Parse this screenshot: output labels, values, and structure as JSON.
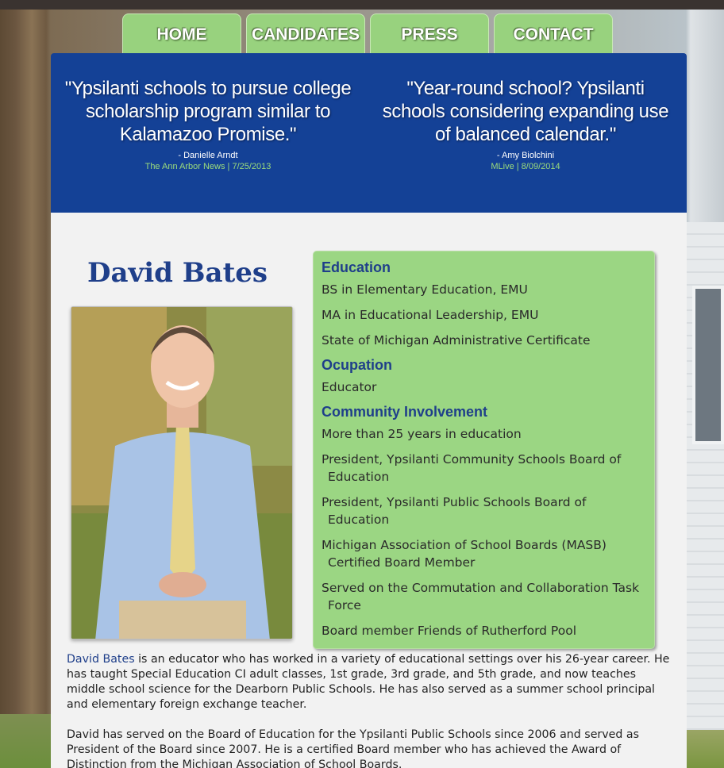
{
  "nav": {
    "items": [
      {
        "label": "HOME"
      },
      {
        "label": "CANDIDATES"
      },
      {
        "label": "PRESS"
      },
      {
        "label": "CONTACT"
      }
    ]
  },
  "quotes": [
    {
      "text": "\"Ypsilanti schools to pursue college scholarship program similar to Kalamazoo Promise.\"",
      "author": "- Danielle Arndt",
      "source": "The Ann Arbor News | 7/25/2013"
    },
    {
      "text": "\"Year-round school? Ypsilanti schools considering expanding use of balanced calendar.\"",
      "author": "- Amy Biolchini",
      "source": "MLive | 8/09/2014"
    }
  ],
  "candidate": {
    "name": "David Bates"
  },
  "info": {
    "education_title": "Education",
    "education": [
      "BS in Elementary Education, EMU",
      "MA in Educational Leadership, EMU",
      "State of Michigan Administrative Certificate"
    ],
    "occupation_title": "Ocupation",
    "occupation": [
      "Educator"
    ],
    "community_title": "Community Involvement",
    "community": [
      "More than 25 years in education",
      "President, Ypsilanti Community Schools Board of Education",
      "President, Ypsilanti Public Schools Board of Education",
      "Michigan Association of School Boards (MASB) Certified Board Member",
      "Served on the Commutation and Collaboration Task Force",
      "Board member Friends of Rutherford Pool"
    ]
  },
  "bio": {
    "name": "David Bates",
    "p1_rest": " is an educator who has worked in a variety of educational settings over his 26-year career. He has taught Special Education CI adult classes, 1st grade, 3rd grade, and 5th grade, and now teaches middle school science for the Dearborn Public Schools. He has also served as a summer school principal and elementary foreign exchange teacher.",
    "p2": "David has served on the Board of Education for the Ypsilanti Public Schools since 2006 and served as President of the Board since 2007. He is a certified Board member who has achieved the Award of Distinction from the Michigan Association of School Boards."
  },
  "colors": {
    "nav_green": "#98d27e",
    "banner_blue": "#144196",
    "heading_blue": "#1f3f8a",
    "info_green": "#9bd683"
  }
}
